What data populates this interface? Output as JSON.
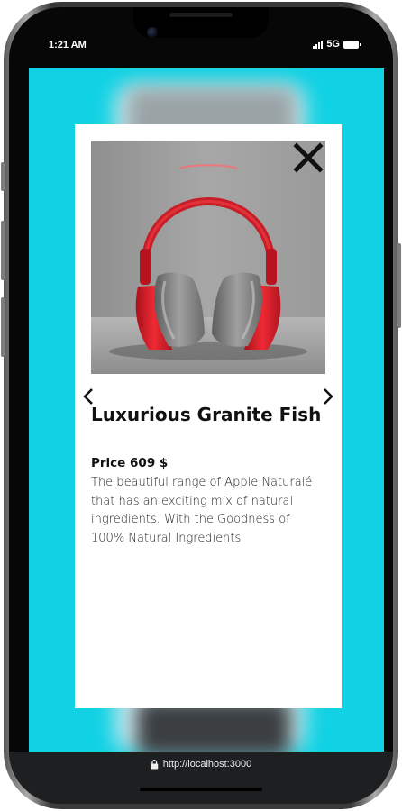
{
  "status_bar": {
    "time": "1:21 AM",
    "network": "5G"
  },
  "product_modal": {
    "title": "Luxurious Granite Fish",
    "price": "Price 609 $",
    "description": "The beautiful range of Apple Naturalé that has an exciting mix of natural ingredients. With the Goodness of 100% Natural Ingredients",
    "image_subject": "red-headphones",
    "icons": {
      "close": "close-icon",
      "prev": "chevron-left-icon",
      "next": "chevron-right-icon"
    }
  },
  "browser": {
    "url": "http://localhost:3000"
  },
  "colors": {
    "background_accent": "#10d2e4",
    "modal_bg": "#ffffff",
    "text_primary": "#111111",
    "headphone_red": "#e3222e"
  }
}
